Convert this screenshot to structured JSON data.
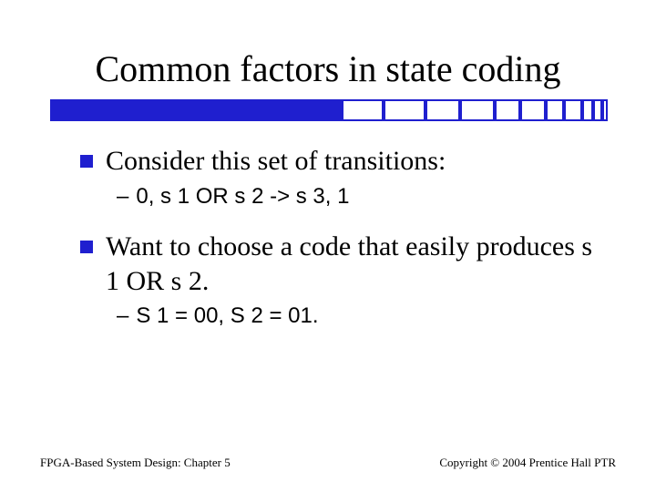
{
  "title": "Common factors in state coding",
  "bullets": [
    {
      "text": "Consider this set of transitions:",
      "sub": "0, s 1 OR s 2 -> s 3, 1"
    },
    {
      "text": "Want to choose a code that easily produces s 1 OR s 2.",
      "sub": "S 1 = 00, S 2 = 01."
    }
  ],
  "footer": {
    "left": "FPGA-Based System Design: Chapter 5",
    "right": "Copyright © 2004 Prentice Hall PTR"
  }
}
